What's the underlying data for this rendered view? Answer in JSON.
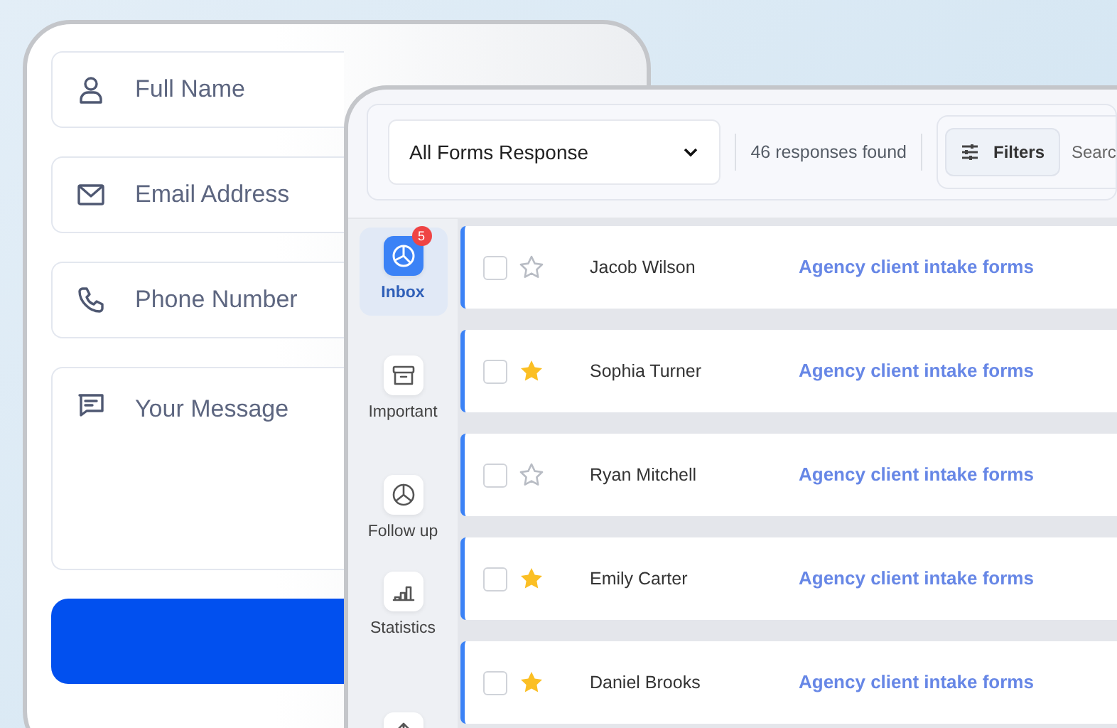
{
  "contact_form": {
    "fields": [
      {
        "kind": "person",
        "placeholder": "Full Name"
      },
      {
        "kind": "mail",
        "placeholder": "Email Address"
      },
      {
        "kind": "phone",
        "placeholder": "Phone Number"
      },
      {
        "kind": "message",
        "placeholder": "Your Message"
      }
    ]
  },
  "responses_window": {
    "toolbar": {
      "form_select": "All Forms Response",
      "count": "46 responses found",
      "filters_button": "Filters",
      "search": {
        "placeholder": "Searc"
      }
    },
    "sidebar": {
      "items": [
        {
          "kind": "inbox",
          "label": "Inbox",
          "badge": "5",
          "selected": true
        },
        {
          "kind": "archive",
          "label": "Important",
          "selected": false
        },
        {
          "kind": "clock",
          "label": "Follow up",
          "selected": false
        },
        {
          "kind": "chart",
          "label": "Statistics",
          "selected": false
        },
        {
          "kind": "upload",
          "selected": false
        }
      ]
    },
    "rows": [
      {
        "checked": false,
        "starred": false,
        "name": "Jacob Wilson",
        "form": "Agency client intake forms"
      },
      {
        "checked": false,
        "starred": true,
        "name": "Sophia Turner",
        "form": "Agency client intake forms"
      },
      {
        "checked": false,
        "starred": false,
        "name": "Ryan Mitchell",
        "form": "Agency client intake forms"
      },
      {
        "checked": false,
        "starred": true,
        "name": "Emily Carter",
        "form": "Agency client intake forms"
      },
      {
        "checked": false,
        "starred": true,
        "name": "Daniel Brooks",
        "form": "Agency client intake forms"
      }
    ]
  }
}
